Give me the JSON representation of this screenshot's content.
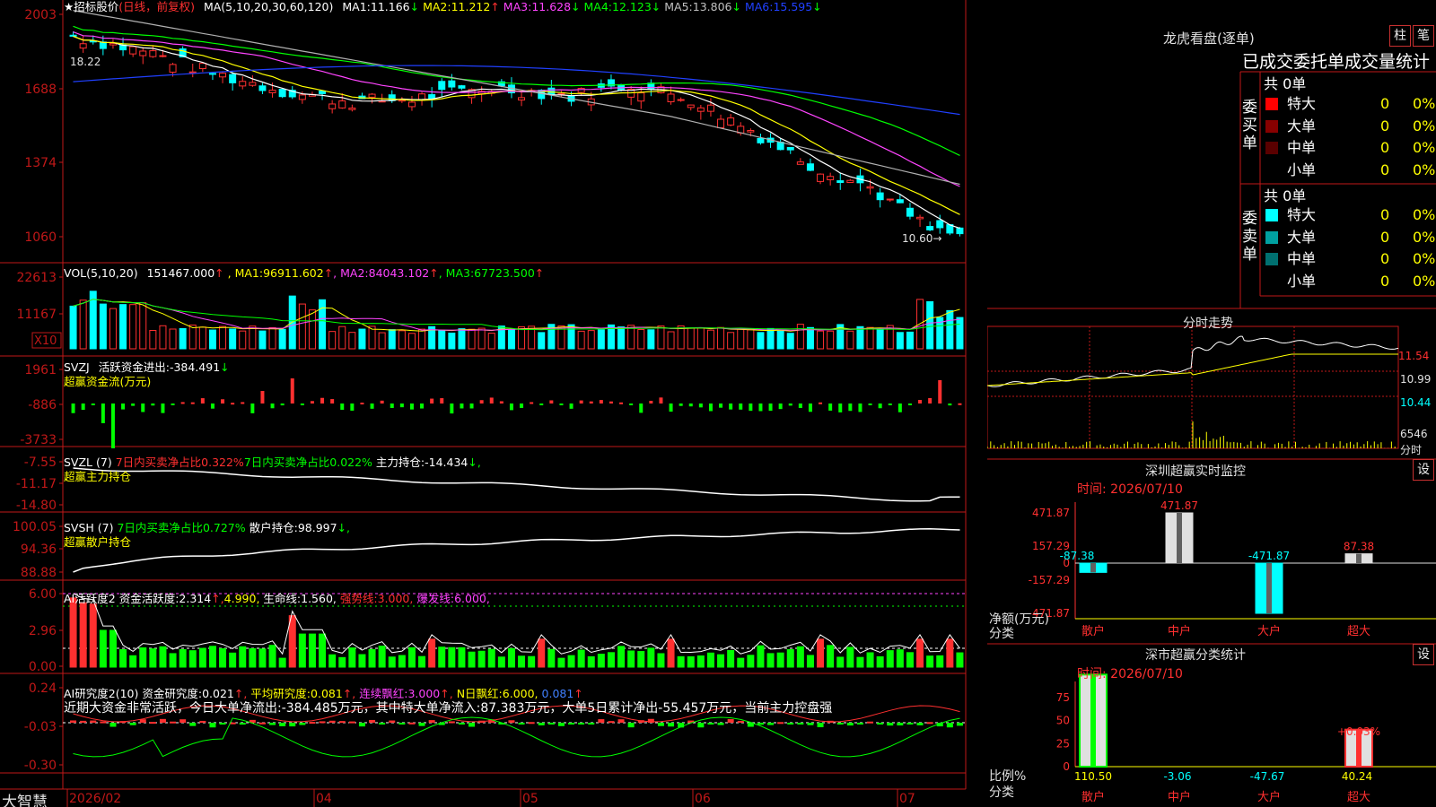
{
  "stock": {
    "name": "★招标股价",
    "period": "(日线，前复权)"
  },
  "colors": {
    "up": "#ff3030",
    "down": "#00ffff",
    "ma5": "#ffffff",
    "ma10": "#ffff00",
    "ma20": "#ff44ff",
    "ma30": "#00ff00",
    "ma60": "#b0b0b0",
    "ma120": "#2040ff",
    "grid": "#c01818"
  },
  "price_panel": {
    "indicator": "MA(5,10,20,30,60,120)",
    "mas": [
      {
        "label": "MA1:",
        "value": "11.166",
        "arrow": "↓",
        "color": "#ffffff"
      },
      {
        "label": "MA2:",
        "value": "11.212",
        "arrow": "↑",
        "color": "#ffff00"
      },
      {
        "label": "MA3:",
        "value": "11.628",
        "arrow": "↓",
        "color": "#ff44ff"
      },
      {
        "label": "MA4:",
        "value": "12.123",
        "arrow": "↓",
        "color": "#00ff00"
      },
      {
        "label": "MA5:",
        "value": "13.806",
        "arrow": "↓",
        "color": "#c0c0c0"
      },
      {
        "label": "MA6:",
        "value": "15.595",
        "arrow": "↓",
        "color": "#2040ff"
      }
    ],
    "yticks": [
      "2003",
      "1688",
      "1374",
      "1060"
    ],
    "high_label": "18.22",
    "low_label": "10.60→"
  },
  "vol_panel": {
    "indicator": "VOL(5,10,20)",
    "value": "151467.000",
    "arrow": "↑",
    "mas": [
      {
        "label": "MA1:",
        "value": "96911.602",
        "arrow": "↑",
        "color": "#ffff00"
      },
      {
        "label": "MA2:",
        "value": "84043.102",
        "arrow": "↑",
        "color": "#ff44ff"
      },
      {
        "label": "MA3:",
        "value": "67723.500",
        "arrow": "↑",
        "color": "#00ff00"
      }
    ],
    "yticks": [
      "22613",
      "11167"
    ],
    "unit": "X10"
  },
  "svzj_panel": {
    "name": "SVZJ",
    "label": "活跃资金进出:",
    "value": "-384.491",
    "arrow": "↓",
    "subtitle": "超赢资金流(万元)",
    "yticks": [
      "1961",
      "-886",
      "-3733"
    ]
  },
  "svzl_panel": {
    "name": "SVZL (7)",
    "t1": "7日内买卖净占比0.322%",
    "t2": "7日内买卖净占比0.022%",
    "label": "主力持仓:",
    "value": "-14.434",
    "arrow": "↓,",
    "subtitle": "超赢主力持仓",
    "yticks": [
      "-7.55",
      "-11.17",
      "-14.80"
    ]
  },
  "svsh_panel": {
    "name": "SVSH (7)",
    "t1": "7日内买卖净占比0.727%",
    "label": "散户持仓:",
    "value": "98.997",
    "arrow": "↓,",
    "subtitle": "超赢散户持仓",
    "yticks": [
      "100.05",
      "94.36",
      "88.88"
    ]
  },
  "ai1_panel": {
    "name": "AI活跃度2",
    "l1": "资金活跃度:",
    "v1": "2.314",
    "a1": "↑,",
    "v2": "4.990,",
    "l3": "生命线:",
    "v3": "1.560,",
    "l4": "强势线:",
    "v4": "3.000,",
    "l5": "爆发线:",
    "v5": "6.000,",
    "yticks": [
      "6.00",
      "2.96",
      "0.00"
    ]
  },
  "ai2_panel": {
    "name": "AI研究度2(10)",
    "l1": "资金研究度:",
    "v1": "0.021",
    "a1": "↑,",
    "l2": "平均研究度:",
    "v2": "0.081",
    "a2": "↑,",
    "l3": "连续飘红:",
    "v3": "3.000",
    "a3": "↑,",
    "l4": "N日飘红:",
    "v4": "6.000,",
    "v5": "0.081",
    "a5": "↑",
    "comment": "近期大资金非常活跃，今日大单净流出:-384.485万元，其中特大单净流入:87.383万元，大单5日累计净出-55.457万元，当前主力控盘强",
    "yticks": [
      "0.24",
      "-0.03",
      "-0.30"
    ]
  },
  "time_axis": {
    "app": "大智慧",
    "labels": [
      "2026/02",
      "04",
      "05",
      "06",
      "07"
    ]
  },
  "lhb": {
    "title": "龙虎看盘(逐单)",
    "btn_zhu": "柱",
    "btn_bi": "笔",
    "subtitle": "已成交委托单成交量统计",
    "buy": {
      "label": "委买单",
      "total": "共 0单",
      "rows": [
        {
          "name": "特大",
          "count": "0",
          "pct": "0%",
          "color": "#ff0000"
        },
        {
          "name": "大单",
          "count": "0",
          "pct": "0%",
          "color": "#880000"
        },
        {
          "name": "中单",
          "count": "0",
          "pct": "0%",
          "color": "#5a0000"
        },
        {
          "name": "小单",
          "count": "0",
          "pct": "0%",
          "color": "#000000"
        }
      ]
    },
    "sell": {
      "label": "委卖单",
      "total": "共 0单",
      "rows": [
        {
          "name": "特大",
          "count": "0",
          "pct": "0%",
          "color": "#00ffff"
        },
        {
          "name": "大单",
          "count": "0",
          "pct": "0%",
          "color": "#00a0a0"
        },
        {
          "name": "中单",
          "count": "0",
          "pct": "0%",
          "color": "#007070"
        },
        {
          "name": "小单",
          "count": "0",
          "pct": "0%",
          "color": "#000000"
        }
      ]
    }
  },
  "intraday": {
    "title": "分时走势",
    "yticks": [
      "11.54",
      "10.99",
      "10.44"
    ],
    "vol_label": "6546",
    "unit": "分时"
  },
  "monitor": {
    "title": "深圳超赢实时监控",
    "btn": "设",
    "date_label": "时间:",
    "date": "2026/07/10",
    "yticks": [
      "471.87",
      "157.29",
      "0",
      "-157.29",
      "-471.87"
    ],
    "ylabel1": "净额(万元)",
    "ylabel2": "分类",
    "categories": [
      "散户",
      "中户",
      "大户",
      "超大"
    ],
    "values": [
      -87.38,
      471.87,
      -471.87,
      87.38
    ],
    "value_labels": [
      "-87.38",
      "471.87",
      "-471.87",
      "87.38"
    ]
  },
  "classify": {
    "title": "深市超赢分类统计",
    "btn": "设",
    "date_label": "时间:",
    "date": "2026/07/10",
    "yticks": [
      "75",
      "50",
      "25",
      "0"
    ],
    "ylabel1": "比例%",
    "ylabel2": "分类",
    "categories": [
      "散户",
      "中户",
      "大户",
      "超大"
    ],
    "values": [
      110.5,
      -3.06,
      -47.67,
      40.24
    ],
    "value_labels": [
      "110.50",
      "-3.06",
      "-47.67",
      "40.24"
    ],
    "annotation": "+0.03%"
  }
}
